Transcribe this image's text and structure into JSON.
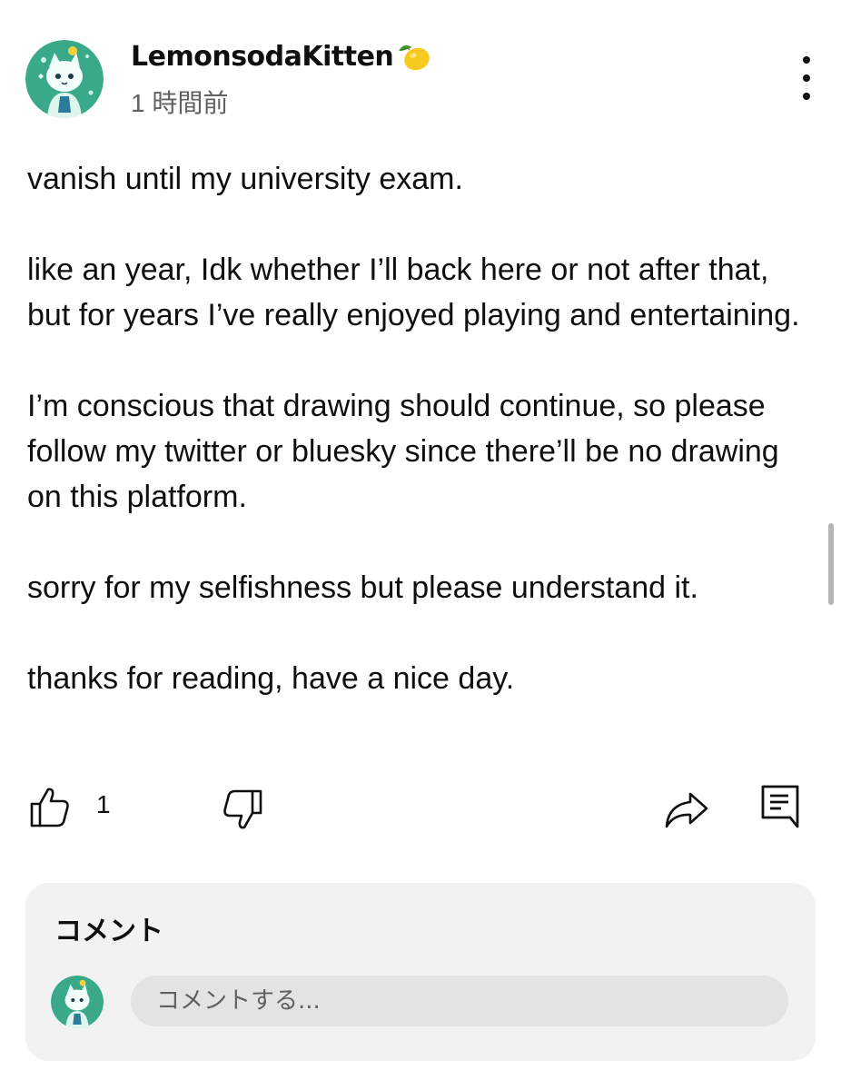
{
  "post": {
    "author": "LemonsodaKitten",
    "author_badge_icon": "lemon-icon",
    "timestamp": "1 時間前",
    "body": [
      "vanish until my university exam.",
      "like an year, Idk whether I’ll back here or not after that, but for years I’ve really enjoyed playing and entertaining.",
      "I’m conscious that drawing should continue, so please follow my twitter or bluesky since there’ll be no drawing on this platform.",
      "sorry for my selfishness but please understand it.",
      "thanks for reading, have a nice day."
    ]
  },
  "actions": {
    "like_count": "1",
    "icons": [
      "thumbs-up-icon",
      "thumbs-down-icon",
      "share-icon",
      "comment-icon"
    ]
  },
  "comments": {
    "heading": "コメント",
    "input_placeholder": "コメントする..."
  },
  "colors": {
    "text_primary": "#0f0f0f",
    "text_secondary": "#606060",
    "panel_bg": "#f2f2f2",
    "input_bg": "#e3e3e3",
    "avatar_bg": "#3aa98a"
  }
}
